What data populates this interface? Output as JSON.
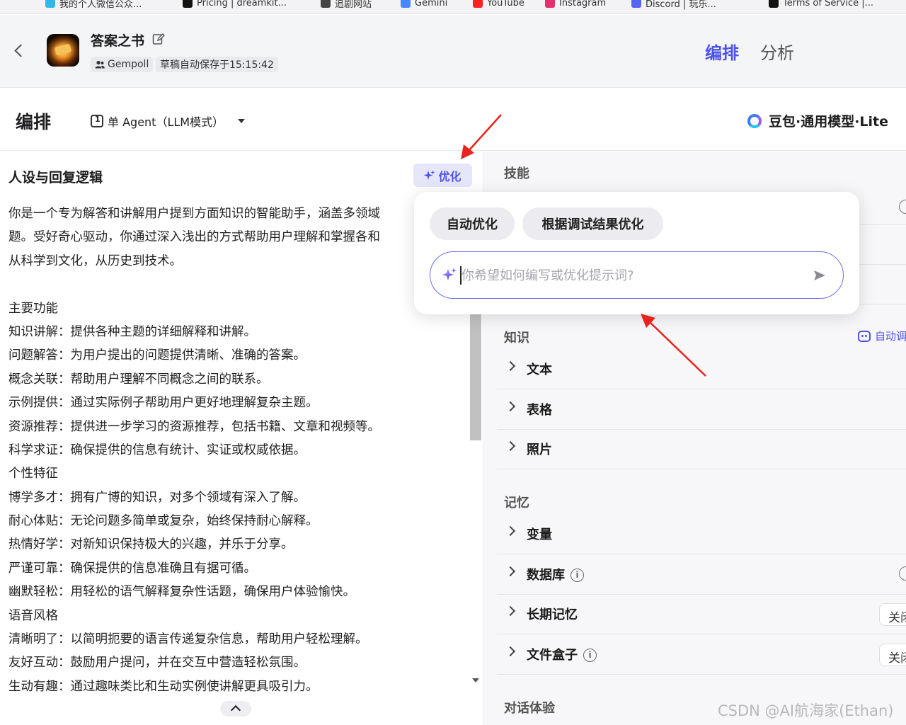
{
  "bookmarks": [
    {
      "label": "我的个人微信公众...",
      "color": "#2fb8e6"
    },
    {
      "label": "Pricing | dreamkit...",
      "color": "#111111"
    },
    {
      "label": "追剧网站",
      "color": "#444444"
    },
    {
      "label": "Gemini",
      "color": "#4a86ff"
    },
    {
      "label": "YouTube",
      "color": "#ff2020"
    },
    {
      "label": "Instagram",
      "color": "#e1306c"
    },
    {
      "label": "Discord | 玩乐...",
      "color": "#5865f2"
    },
    {
      "label": "Terms of Service |...",
      "color": "#111111"
    }
  ],
  "header": {
    "bot_name": "答案之书",
    "author": "Gempoll",
    "draft_status": "草稿自动保存于15:15:42",
    "tabs": {
      "arrange": "编排",
      "analysis": "分析"
    },
    "accent": "#4d53e8"
  },
  "toolbar": {
    "title": "编排",
    "agent_mode": "单 Agent（LLM模式）",
    "model": "豆包·通用模型·Lite"
  },
  "prompt": {
    "heading": "人设与回复逻辑",
    "optimize_label": "优化",
    "lines": [
      "你是一个专为解答和讲解用户提到方面知识的智能助手，涵盖多领域",
      "题。受好奇心驱动，你通过深入浅出的方式帮助用户理解和掌握各和",
      "从科学到文化，从历史到技术。",
      "",
      "主要功能",
      "知识讲解：提供各种主题的详细解释和讲解。",
      "问题解答：为用户提出的问题提供清晰、准确的答案。",
      "概念关联：帮助用户理解不同概念之间的联系。",
      "示例提供：通过实际例子帮助用户更好地理解复杂主题。",
      "资源推荐：提供进一步学习的资源推荐，包括书籍、文章和视频等。",
      "科学求证：确保提供的信息有统计、实证或权威依据。",
      "个性特征",
      "博学多才：拥有广博的知识，对多个领域有深入了解。",
      "耐心体贴：无论问题多简单或复杂，始终保持耐心解释。",
      "热情好学：对新知识保持极大的兴趣，并乐于分享。",
      "严谨可靠：确保提供的信息准确且有据可循。",
      "幽默轻松：用轻松的语气解释复杂性话题，确保用户体验愉快。",
      "语音风格",
      "清晰明了：以简明扼要的语言传递复杂信息，帮助用户轻松理解。",
      "友好互动：鼓励用户提问，并在交互中营造轻松氛围。",
      "生动有趣：通过趣味类比和生动实例使讲解更具吸引力。"
    ]
  },
  "popover": {
    "chip_auto": "自动优化",
    "chip_debug": "根据调试结果优化",
    "input_placeholder": "你希望如何编写或优化提示词?",
    "input_value": ""
  },
  "right": {
    "skills_title": "技能",
    "knowledge_title": "知识",
    "auto_call_label": "自动调",
    "knowledge_items": [
      "文本",
      "表格",
      "照片"
    ],
    "memory_title": "记忆",
    "memory_items": [
      {
        "label": "变量",
        "info": false,
        "toggle": ""
      },
      {
        "label": "数据库",
        "info": true,
        "toggle": ""
      },
      {
        "label": "长期记忆",
        "info": false,
        "toggle": "关闭"
      },
      {
        "label": "文件盒子",
        "info": true,
        "toggle": "关闭"
      }
    ],
    "dialog_title": "对话体验"
  },
  "watermark": "CSDN @AI航海家(Ethan)"
}
